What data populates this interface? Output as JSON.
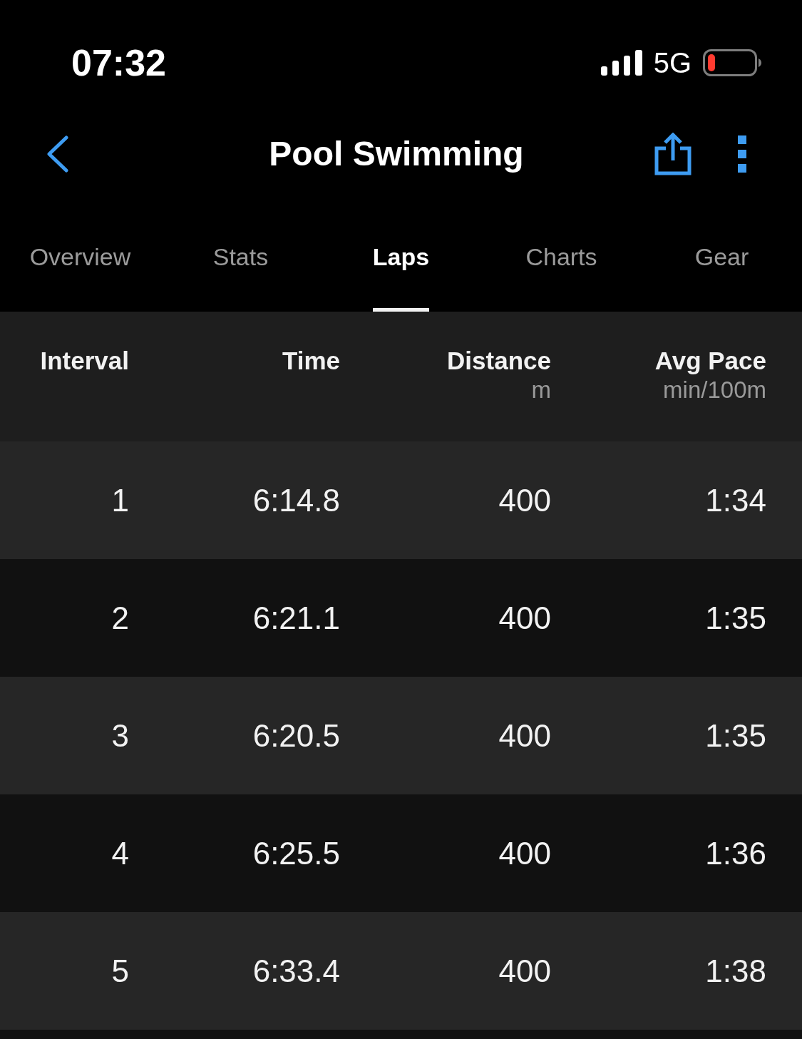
{
  "status_bar": {
    "time": "07:32",
    "network": "5G"
  },
  "nav": {
    "title": "Pool Swimming"
  },
  "tabs": [
    {
      "label": "Overview",
      "selected": false
    },
    {
      "label": "Stats",
      "selected": false
    },
    {
      "label": "Laps",
      "selected": true
    },
    {
      "label": "Charts",
      "selected": false
    },
    {
      "label": "Gear",
      "selected": false
    }
  ],
  "table": {
    "columns": [
      {
        "title": "Interval"
      },
      {
        "title": "Time"
      },
      {
        "title": "Distance",
        "unit": "m"
      },
      {
        "title": "Avg Pace",
        "unit": "min/100m"
      }
    ],
    "rows": [
      {
        "cells": [
          "1",
          "6:14.8",
          "400",
          "1:34"
        ]
      },
      {
        "cells": [
          "2",
          "6:21.1",
          "400",
          "1:35"
        ]
      },
      {
        "cells": [
          "3",
          "6:20.5",
          "400",
          "1:35"
        ]
      },
      {
        "cells": [
          "4",
          "6:25.5",
          "400",
          "1:36"
        ]
      },
      {
        "cells": [
          "5",
          "6:33.4",
          "400",
          "1:38"
        ]
      }
    ]
  }
}
